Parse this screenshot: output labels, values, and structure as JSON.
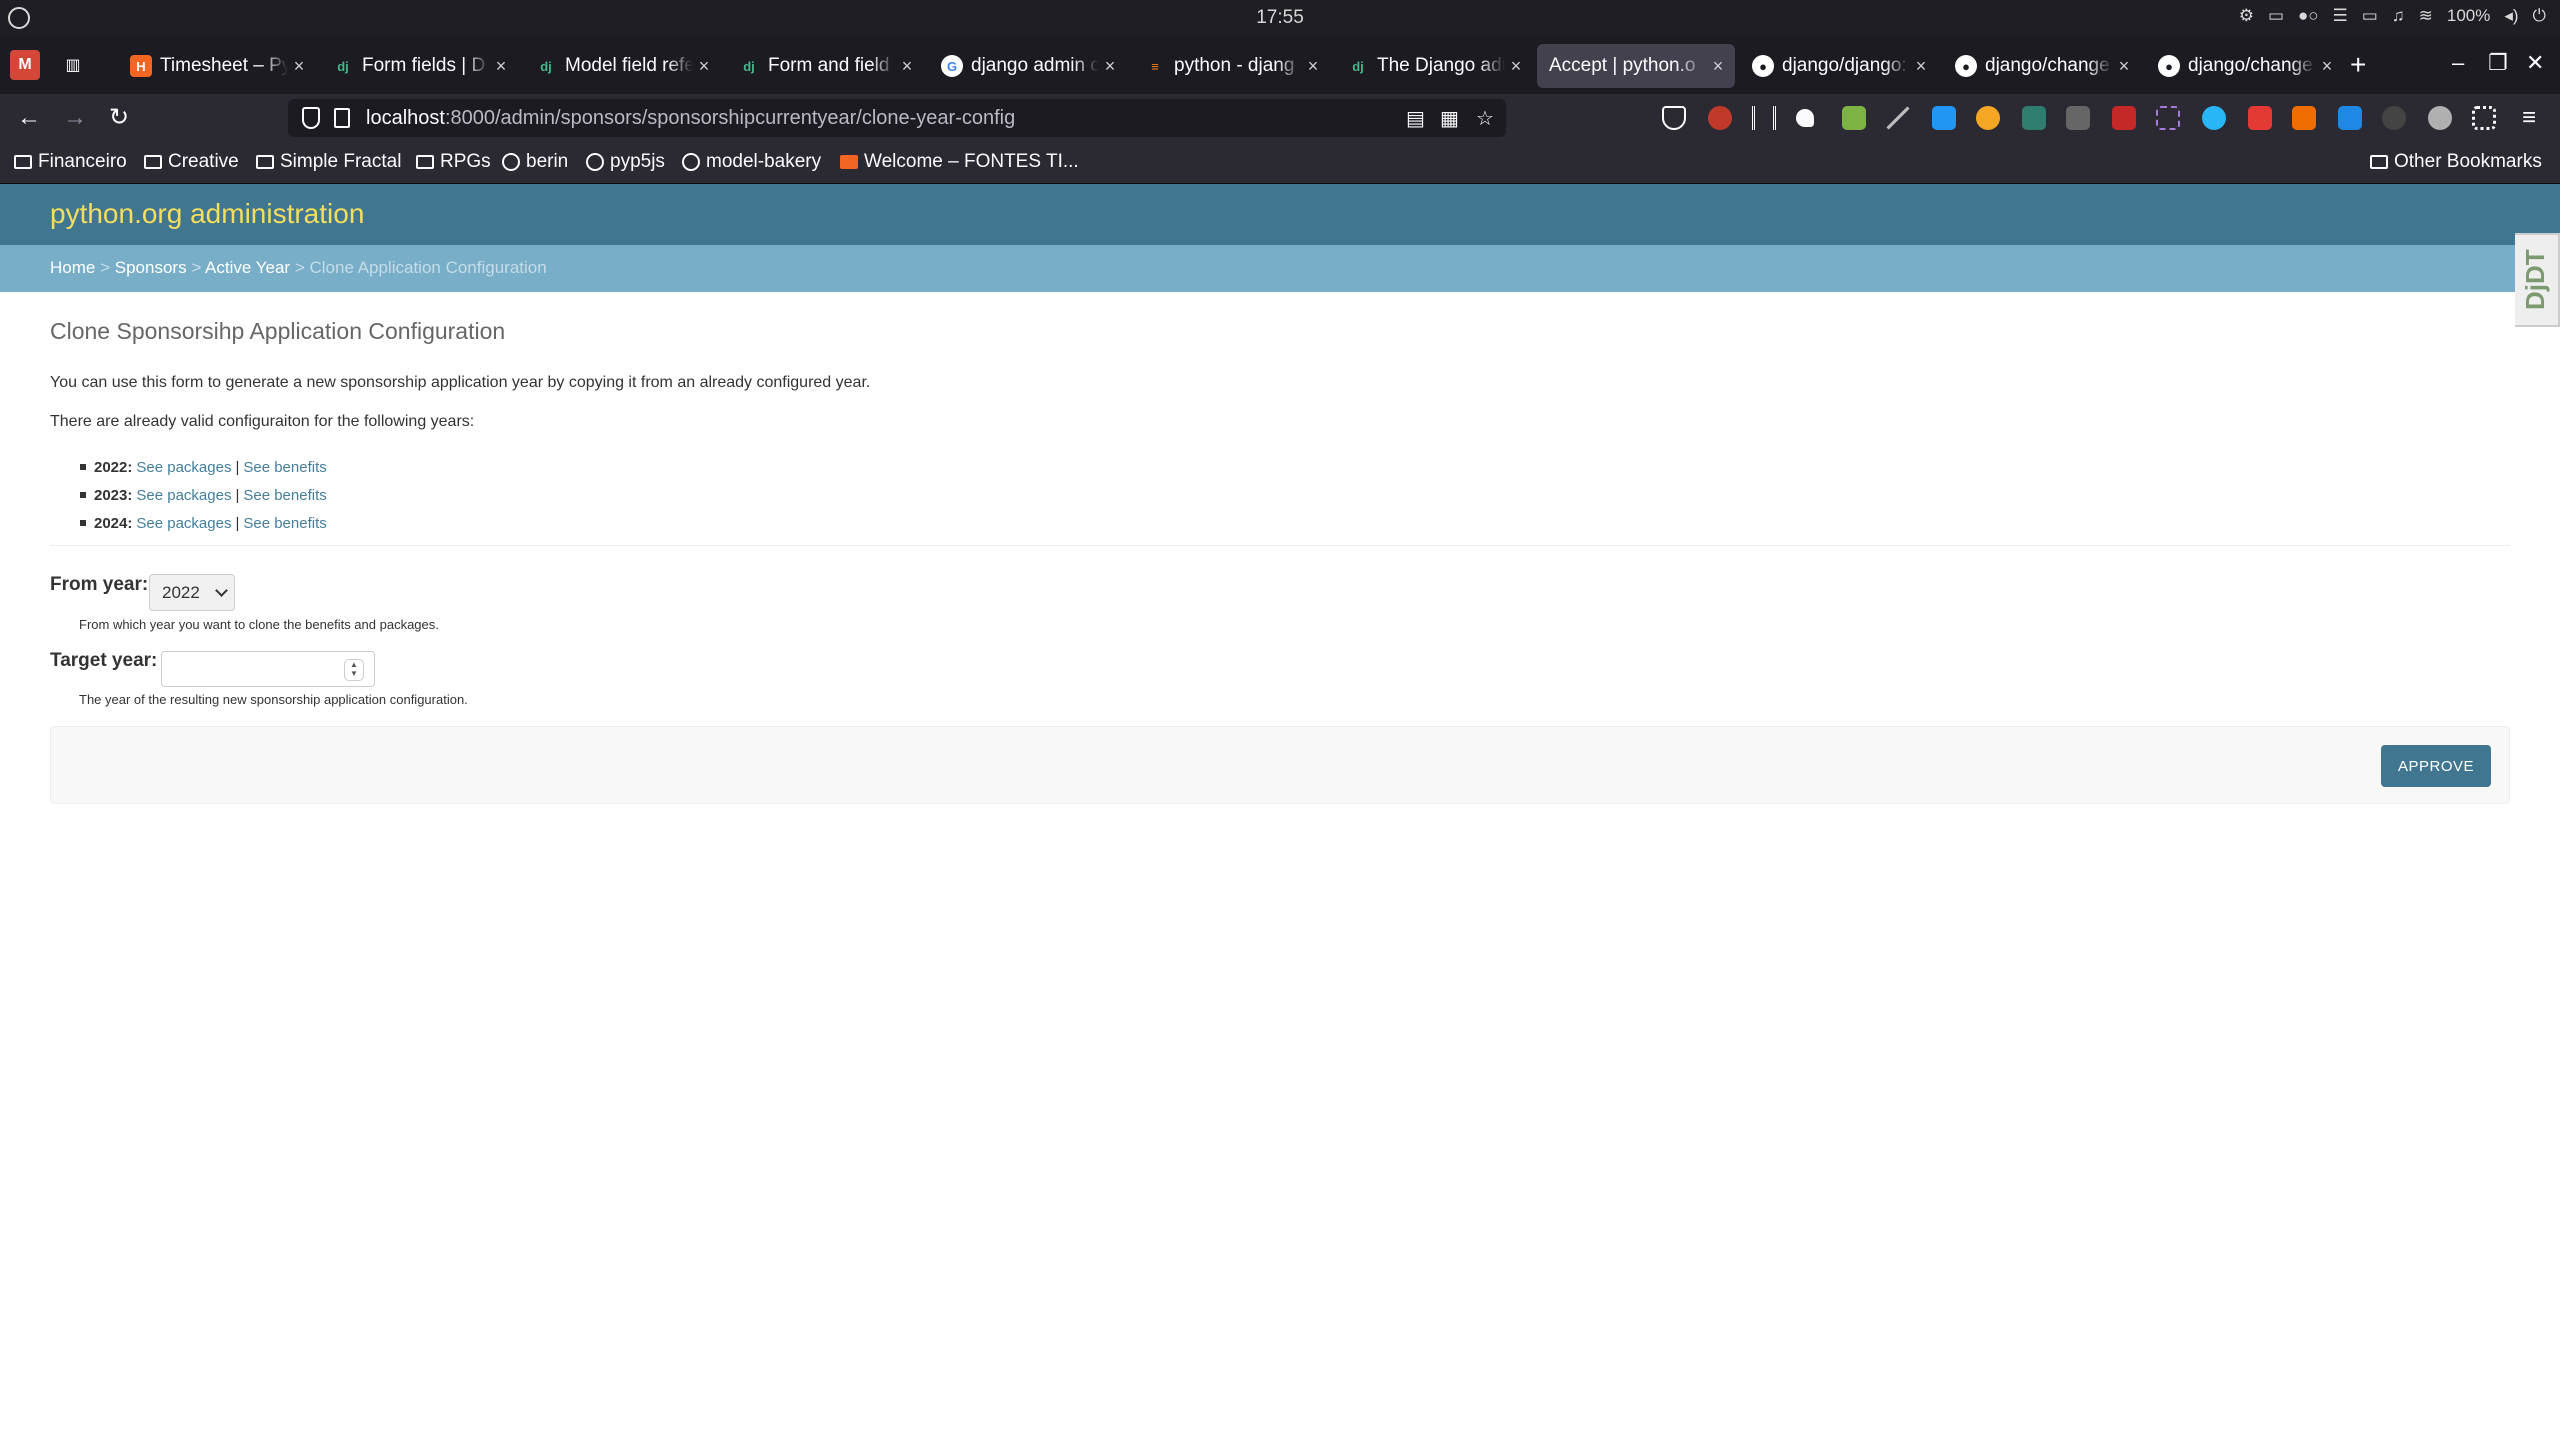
{
  "system": {
    "clock": "17:55",
    "battery": "100%"
  },
  "tabs": [
    {
      "title": "Timesheet – Py",
      "favicon": "orange-h-icon",
      "active": false
    },
    {
      "title": "Form fields | D",
      "favicon": "django-icon",
      "active": false
    },
    {
      "title": "Model field refe",
      "favicon": "django-icon",
      "active": false
    },
    {
      "title": "Form and field",
      "favicon": "django-icon",
      "active": false
    },
    {
      "title": "django admin c",
      "favicon": "google-icon",
      "active": false
    },
    {
      "title": "python - djang",
      "favicon": "stackoverflow-icon",
      "active": false
    },
    {
      "title": "The Django adm",
      "favicon": "django-icon",
      "active": false
    },
    {
      "title": "Accept | python.o",
      "favicon": "none",
      "active": true
    },
    {
      "title": "django/django:",
      "favicon": "github-icon",
      "active": false
    },
    {
      "title": "django/change",
      "favicon": "github-icon",
      "active": false
    },
    {
      "title": "django/change",
      "favicon": "github-icon",
      "active": false
    }
  ],
  "urlbar": {
    "host": "localhost",
    "path": ":8000/admin/sponsors/sponsorshipcurrentyear/clone-year-config"
  },
  "bookmarks": [
    {
      "label": "Financeiro",
      "icon": "folder-icon"
    },
    {
      "label": "Creative",
      "icon": "folder-icon"
    },
    {
      "label": "Simple Fractal",
      "icon": "folder-icon"
    },
    {
      "label": "RPGs",
      "icon": "folder-icon"
    },
    {
      "label": "berin",
      "icon": "globe-icon"
    },
    {
      "label": "pyp5js",
      "icon": "globe-icon"
    },
    {
      "label": "model-bakery",
      "icon": "github-icon"
    },
    {
      "label": "Welcome – FONTES TI...",
      "icon": "orange-h-icon"
    }
  ],
  "other_bookmarks": "Other Bookmarks",
  "admin": {
    "brand": "python.org administration",
    "breadcrumbs": [
      "Home",
      "Sponsors",
      "Active Year"
    ],
    "breadcrumb_current": "Clone Application Configuration",
    "djdt": "DjDT",
    "title": "Clone Sponsorsihp Application Configuration",
    "intro": "You can use this form to generate a new sponsorship application year by copying it from an already configured year.",
    "years_intro": "There are already valid configuraiton for the following years:",
    "years": [
      {
        "year": "2022:",
        "packages": "See packages",
        "benefits": "See benefits"
      },
      {
        "year": "2023:",
        "packages": "See packages",
        "benefits": "See benefits"
      },
      {
        "year": "2024:",
        "packages": "See packages",
        "benefits": "See benefits"
      }
    ],
    "separator": "|",
    "from_year": {
      "label": "From year:",
      "value": "2022",
      "help": "From which year you want to clone the benefits and packages."
    },
    "target_year": {
      "label": "Target year:",
      "value": "",
      "help": "The year of the resulting new sponsorship application configuration."
    },
    "approve_label": "APPROVE"
  },
  "colors": {
    "header": "#417690",
    "breadcrumbs": "#79aec8",
    "brand": "#f5dd5d",
    "link": "#447e9b"
  }
}
